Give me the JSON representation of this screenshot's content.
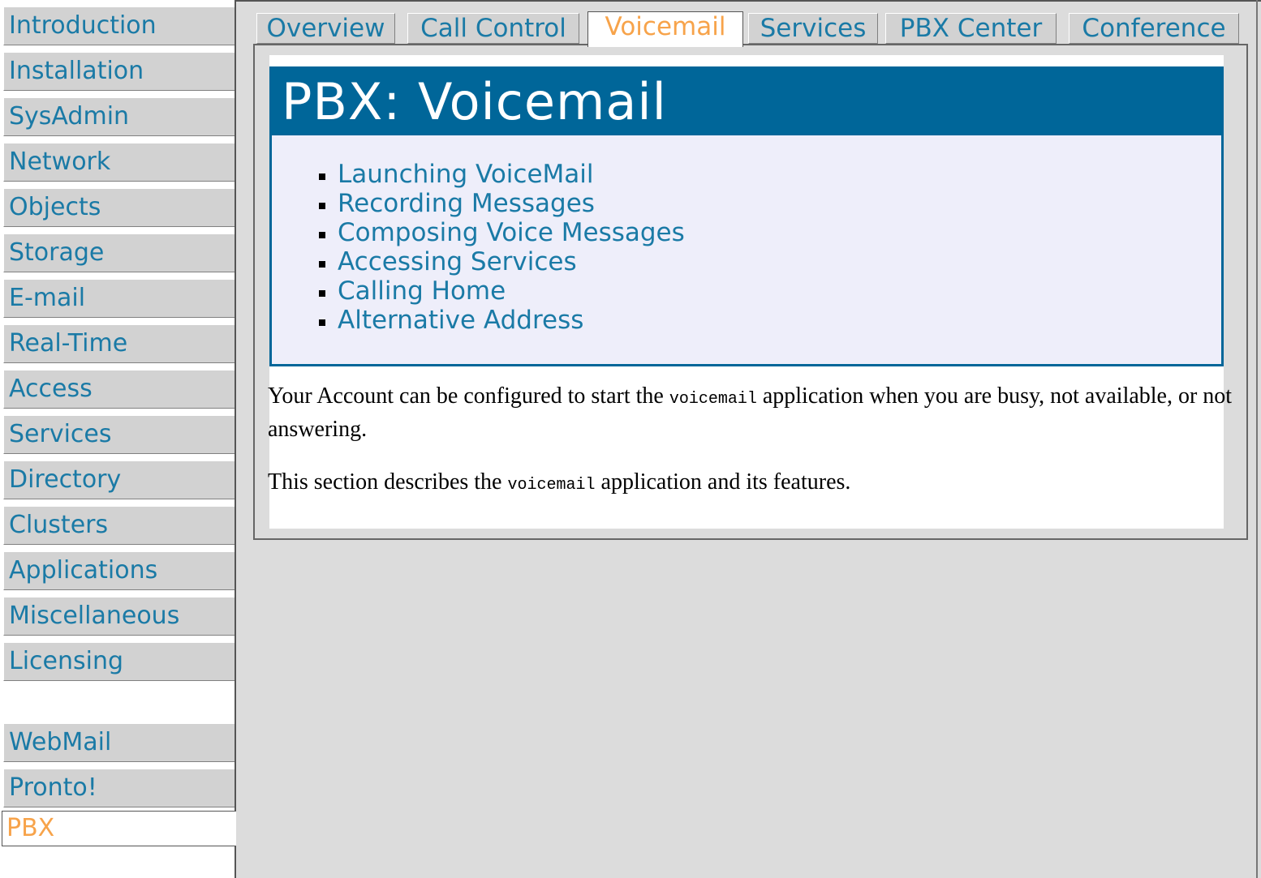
{
  "sidebar": {
    "items": [
      {
        "label": "Introduction"
      },
      {
        "label": "Installation"
      },
      {
        "label": "SysAdmin"
      },
      {
        "label": "Network"
      },
      {
        "label": "Objects"
      },
      {
        "label": "Storage"
      },
      {
        "label": "E-mail"
      },
      {
        "label": "Real-Time"
      },
      {
        "label": "Access"
      },
      {
        "label": "Services"
      },
      {
        "label": "Directory"
      },
      {
        "label": "Clusters"
      },
      {
        "label": "Applications"
      },
      {
        "label": "Miscellaneous"
      },
      {
        "label": "Licensing"
      }
    ],
    "secondary_items": [
      {
        "label": "WebMail"
      },
      {
        "label": "Pronto!"
      },
      {
        "label": "PBX",
        "active": true
      }
    ]
  },
  "tabs": [
    {
      "label": "Overview"
    },
    {
      "label": "Call Control"
    },
    {
      "label": "Voicemail",
      "active": true
    },
    {
      "label": "Services"
    },
    {
      "label": "PBX Center"
    },
    {
      "label": "Conference"
    }
  ],
  "main": {
    "title": "PBX: Voicemail",
    "toc": [
      {
        "label": "Launching VoiceMail"
      },
      {
        "label": "Recording Messages"
      },
      {
        "label": "Composing Voice Messages"
      },
      {
        "label": "Accessing Services"
      },
      {
        "label": "Calling Home"
      },
      {
        "label": "Alternative Address"
      }
    ],
    "paragraphs": [
      {
        "before": "Your Account can be configured to start the ",
        "code": "voicemail",
        "after": " application when you are busy, not available, or not answering."
      },
      {
        "before": "This section describes the ",
        "code": "voicemail",
        "after": " application and its features."
      }
    ]
  },
  "colors": {
    "link": "#1a7aa6",
    "active": "#f7a34a",
    "title_bar": "#006699",
    "toc_background": "#eeeefa",
    "nav_background": "#d2d2d2",
    "page_background": "#dcdcdc"
  }
}
